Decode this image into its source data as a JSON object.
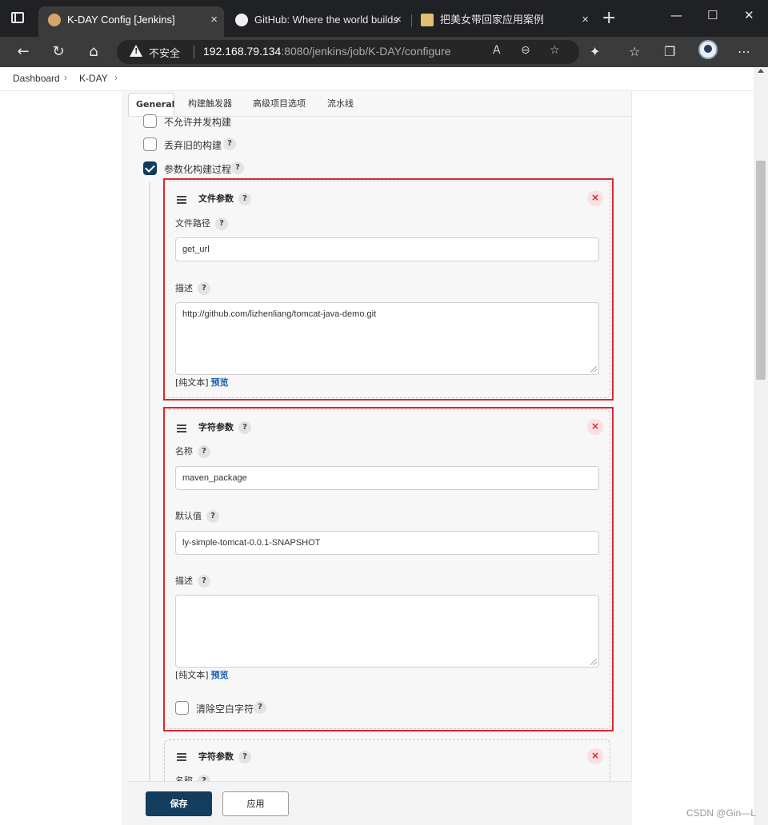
{
  "browser": {
    "tabs": [
      {
        "title": "K-DAY Config [Jenkins]",
        "active": true,
        "icon": "jenkins-icon"
      },
      {
        "title": "GitHub: Where the world builds",
        "active": false,
        "icon": "github-icon"
      },
      {
        "title": "把美女带回家应用案例",
        "active": false,
        "icon": "image-icon"
      }
    ],
    "tab_close_glyph": "×",
    "new_tab_glyph": "+",
    "window_controls": [
      "—",
      "☐",
      "✕"
    ],
    "security_label": "不安全",
    "url_host": "192.168.79.134",
    "url_rest": ":8080/jenkins/job/K-DAY/configure"
  },
  "breadcrumb": {
    "items": [
      "Dashboard",
      "K-DAY"
    ],
    "separator": "›"
  },
  "config_tabs": [
    "General",
    "构建触发器",
    "高级项目选项",
    "流水线"
  ],
  "options": [
    {
      "label": "不允许并发构建",
      "checked": false,
      "has_help": false
    },
    {
      "label": "丢弃旧的构建",
      "checked": false,
      "has_help": true
    },
    {
      "label": "参数化构建过程",
      "checked": true,
      "has_help": true
    }
  ],
  "help_glyph": "?",
  "delete_glyph": "×",
  "parameters": [
    {
      "type_title": "文件参数",
      "path_label": "文件路径",
      "path_value": "get_url",
      "desc_label": "描述",
      "desc_value": "http://github.com/lizhenliang/tomcat-java-demo.git",
      "format_text": "[纯文本]",
      "preview_link": "预览"
    },
    {
      "type_title": "字符参数",
      "name_label": "名称",
      "name_value": "maven_package",
      "default_label": "默认值",
      "default_value": "ly-simple-tomcat-0.0.1-SNAPSHOT",
      "desc_label": "描述",
      "desc_value": "",
      "format_text": "[纯文本]",
      "preview_link": "预览",
      "trim_label": "清除空白字符",
      "trim_checked": false
    },
    {
      "type_title": "字符参数",
      "name_label": "名称"
    }
  ],
  "actions": {
    "save": "保存",
    "apply": "应用"
  },
  "watermark": "CSDN @Gin—L",
  "colors": {
    "primary": "#123d5e",
    "highlight": "#e0242f",
    "link": "#1a60b8"
  }
}
